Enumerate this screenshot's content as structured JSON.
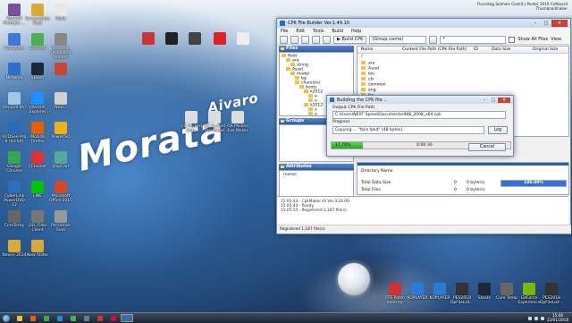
{
  "desktop": {
    "wallpaper_text": [
      "Aivaro",
      "Morata"
    ],
    "top_right_text": "Flucintag Salmeis Conkit | Poster 2019 Cefboard Thumbnailmaker",
    "icons_left": [
      {
        "label": "WinRAR Portable ...",
        "icon": "winrar-icon",
        "color": "#7a4fa0"
      },
      {
        "label": "Screenshots Pack",
        "icon": "folder-icon",
        "color": "#d9a93a"
      },
      {
        "label": "Paint",
        "icon": "paint-icon",
        "color": "#e8e8e8"
      },
      {
        "label": "Computer",
        "icon": "computer-icon",
        "color": "#3a7bd5"
      },
      {
        "label": "uTorrent",
        "icon": "utorrent-icon",
        "color": "#4caf50"
      },
      {
        "label": "Reshade (Activated Loader)",
        "icon": "reshade-icon",
        "color": "#888888"
      },
      {
        "label": "Network",
        "icon": "network-icon",
        "color": "#2b6fc9"
      },
      {
        "label": "Steam",
        "icon": "steam-icon",
        "color": "#1b2838"
      },
      {
        "label": "",
        "icon": "app-icon",
        "color": "#c43"
      },
      {
        "label": "Recycle Bin",
        "icon": "recycle-bin-icon",
        "color": "#9ec7e8"
      },
      {
        "label": "Internet Explorer",
        "icon": "ie-icon",
        "color": "#1e90ff"
      },
      {
        "label": "New...",
        "icon": "file-icon",
        "color": "#d0d0d0"
      },
      {
        "label": "ACDSee Pro 9 (64-bit)",
        "icon": "acdsee-icon",
        "color": "#2a6bb5"
      },
      {
        "label": "Mozilla Firefox",
        "icon": "firefox-icon",
        "color": "#e66000"
      },
      {
        "label": "PowerISO",
        "icon": "poweriso-icon",
        "color": "#f2b01e"
      },
      {
        "label": "Google Chrome",
        "icon": "chrome-icon",
        "color": "#34a853"
      },
      {
        "label": "CCleaner",
        "icon": "ccleaner-icon",
        "color": "#d33"
      },
      {
        "label": "SnipCart",
        "icon": "snip-icon",
        "color": "#5a9"
      },
      {
        "label": "CyberLink PowerDVD 12",
        "icon": "powerdvd-icon",
        "color": "#2d6fb8"
      },
      {
        "label": "LINE",
        "icon": "line-icon",
        "color": "#00c300"
      },
      {
        "label": "Microsoft Office 2010",
        "icon": "office-icon",
        "color": "#d24726"
      },
      {
        "label": "CoreTemp",
        "icon": "coretemp-icon",
        "color": "#666"
      },
      {
        "label": "DLL Files Client",
        "icon": "dll-icon",
        "color": "#777"
      },
      {
        "label": "Persomos Tools",
        "icon": "tools-icon",
        "color": "#999"
      },
      {
        "label": "Nexon 2014",
        "icon": "folder-icon",
        "color": "#d9a93a"
      },
      {
        "label": "New folder",
        "icon": "folder-icon",
        "color": "#d9a93a"
      }
    ],
    "icons_mid": [
      {
        "label": "",
        "icon": "app-icon",
        "color": "#c33"
      },
      {
        "label": "",
        "icon": "app-icon",
        "color": "#222"
      },
      {
        "label": "",
        "icon": "app-icon",
        "color": "#444"
      },
      {
        "label": "",
        "icon": "app-icon",
        "color": "#d22"
      },
      {
        "label": "",
        "icon": "app-icon",
        "color": "#eee"
      },
      {
        "label": "OS Packed Data",
        "icon": "file-icon",
        "color": "#ddd"
      },
      {
        "label": "OS Packed File Maker",
        "icon": "file-icon",
        "color": "#ddd"
      },
      {
        "label": "OS Packed Exe Maker",
        "icon": "file-icon",
        "color": "#ddd"
      }
    ],
    "icons_bottom": [
      {
        "label": "PTE Patch Selector",
        "icon": "pte-icon",
        "color": "#c33"
      },
      {
        "label": "KOPLAYER",
        "icon": "koplayer-icon",
        "color": "#2a7bd5"
      },
      {
        "label": "KOPLAYER",
        "icon": "koplayer-icon",
        "color": "#2a7bd5"
      },
      {
        "label": "PES2018 DpFileList...",
        "icon": "pes-icon",
        "color": "#333"
      },
      {
        "label": "Steam",
        "icon": "steam-icon",
        "color": "#1b2838"
      },
      {
        "label": "Core Temp",
        "icon": "coretemp-icon",
        "color": "#666"
      },
      {
        "label": "GeForce Experience",
        "icon": "geforce-icon",
        "color": "#76b900"
      },
      {
        "label": "PES2018 DpFileList...",
        "icon": "pes-icon",
        "color": "#333"
      }
    ]
  },
  "cpk_window": {
    "title": "CPK File Builder Ver.1.49.10",
    "menu": [
      "File",
      "Edit",
      "Tools",
      "Build",
      "Help"
    ],
    "toolbar": {
      "build_label": "Build CPK",
      "group_select": "(Group name)",
      "filter_input": "*",
      "show_all_label": "Show All Files",
      "view_label": "View"
    },
    "files_header": "Files",
    "tree": [
      "Root",
      "ara",
      "string",
      "Asset",
      "model",
      "bg",
      "character",
      "boots",
      "k2012",
      "a",
      "e",
      "k2012",
      "e",
      "a"
    ],
    "list_columns": [
      "Name",
      "Content File Path (CPK File Path)",
      "ID",
      "Data Size",
      "Original Size"
    ],
    "list_path": "/",
    "list_items": [
      "ara",
      "Asset",
      "bin",
      "cfs",
      "common",
      "eng",
      "fra",
      "ger"
    ],
    "groups_header": "Groups",
    "attributes_header": "Attributes",
    "attributes_value": "(none)",
    "info": {
      "directory_name_label": "Directory Name",
      "total_data_size_label": "Total Data Size",
      "total_data_size_value": "0",
      "total_data_size_unit": "0 byte(s)",
      "total_files_label": "Total Files",
      "total_files_value": "0",
      "total_files_unit": "0 byte(s)",
      "ratio_text": "100.00%",
      "ratio_fraction": 1.0
    },
    "log": [
      "15:05:44 - CpkMaker.dll Ver.3.24.00",
      "15:05:44 - Ready.",
      "15:05:55 - Registered 1,187 file(s)."
    ],
    "status": "Registered 1,187 file(s)."
  },
  "dialog": {
    "title": "Building the CPK file ...",
    "output_label": "Output CPK File Path",
    "output_path": "C:\\Users\\NEXT Speed\\Documents\\988_2008_x64.cpk",
    "progress_label": "Progress",
    "progress_text": "Copying ... \"face.fpkd\" (48 bytes).",
    "log_button": "Log",
    "percent_text": "17.70%",
    "percent_value": 0.177,
    "elapsed": "0:00:30",
    "cancel_button": "Cancel"
  },
  "taskbar": {
    "apps": [
      {
        "name": "explorer",
        "color": "#f0c040"
      },
      {
        "name": "firefox",
        "color": "#e66000"
      },
      {
        "name": "chrome",
        "color": "#34a853"
      },
      {
        "name": "media",
        "color": "#1e88e5"
      },
      {
        "name": "utorrent",
        "color": "#4caf50"
      },
      {
        "name": "steam",
        "color": "#5c7e9e"
      },
      {
        "name": "app",
        "color": "#c33"
      },
      {
        "name": "app2",
        "color": "#d04"
      },
      {
        "name": "cpk-builder",
        "color": "#2a6fbf"
      }
    ],
    "time": "15:08",
    "date": "22/01/2018"
  }
}
